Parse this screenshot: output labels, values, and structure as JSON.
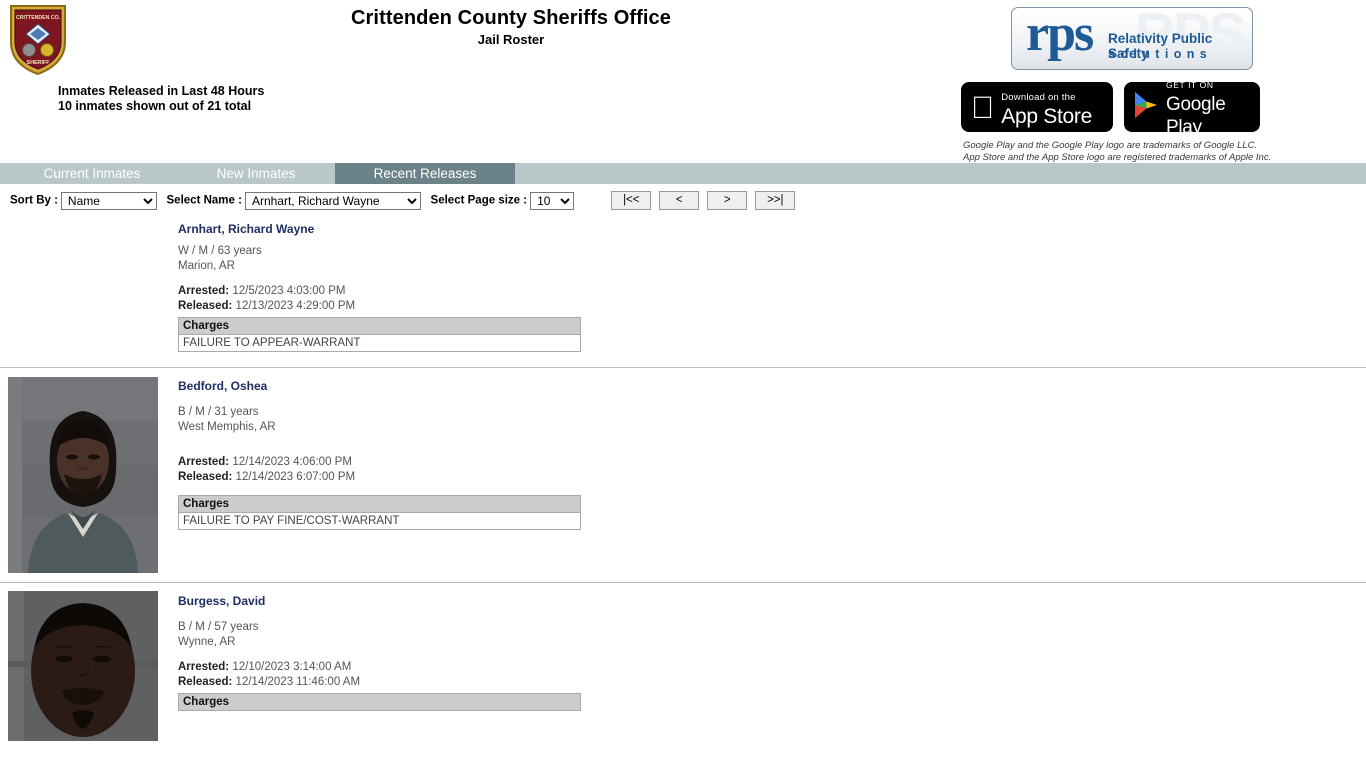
{
  "header": {
    "title": "Crittenden County Sheriffs Office",
    "subtitle": "Jail Roster",
    "badge_logo_top_text": "CRITTENDEN CO.",
    "badge_logo_bottom_text": "SHERIFF",
    "summary_line1": "Inmates Released in Last 48 Hours",
    "summary_line2": "10 inmates shown out of 21 total"
  },
  "branding": {
    "rps_wordmark": "rps",
    "rps_ghost": "RPS",
    "rps_line1": "Relativity Public Safety",
    "rps_line2": "solutions",
    "appstore_small": "Download on the",
    "appstore_large": "App Store",
    "gplay_small": "GET IT ON",
    "gplay_large": "Google Play",
    "trademark_line1": "Google Play and the Google Play logo are trademarks of Google LLC.",
    "trademark_line2": "App Store and the App Store logo are registered trademarks of Apple Inc.",
    "rps_blue": "#1d5a96"
  },
  "tabs": [
    {
      "label": "Current Inmates",
      "active": false
    },
    {
      "label": "New Inmates",
      "active": false
    },
    {
      "label": "Recent Releases",
      "active": true
    }
  ],
  "tab_colors": {
    "bar": "#b9c7c8",
    "active": "#6b8289",
    "text": "#ffffff"
  },
  "controls": {
    "sort_label": "Sort By :",
    "sort_value": "Name",
    "name_label": "Select Name :",
    "name_value": "Arnhart, Richard Wayne",
    "pagesize_label": "Select Page size :",
    "pagesize_value": "10",
    "pager": [
      {
        "label": "|<<",
        "name": "first-page-button"
      },
      {
        "label": "<",
        "name": "prev-page-button"
      },
      {
        "label": ">",
        "name": "next-page-button"
      },
      {
        "label": ">>|",
        "name": "last-page-button"
      }
    ]
  },
  "charges_header": "Charges",
  "arrested_label": "Arrested:",
  "released_label": "Released:",
  "records": [
    {
      "name": "Arnhart, Richard Wayne",
      "demographics": "W / M / 63 years",
      "city": "Marion, AR",
      "arrested": "12/5/2023 4:03:00 PM",
      "released": "12/13/2023 4:29:00 PM",
      "charges": [
        "FAILURE TO APPEAR-WARRANT"
      ],
      "has_photo": false
    },
    {
      "name": "Bedford, Oshea",
      "demographics": "B / M / 31 years",
      "city": "West Memphis, AR",
      "arrested": "12/14/2023 4:06:00 PM",
      "released": "12/14/2023 6:07:00 PM",
      "charges": [
        "FAILURE TO PAY FINE/COST-WARRANT"
      ],
      "has_photo": true
    },
    {
      "name": "Burgess, David",
      "demographics": "B / M / 57 years",
      "city": "Wynne, AR",
      "arrested": "12/10/2023 3:14:00 AM",
      "released": "12/14/2023 11:46:00 AM",
      "charges": [],
      "has_photo": true
    }
  ]
}
